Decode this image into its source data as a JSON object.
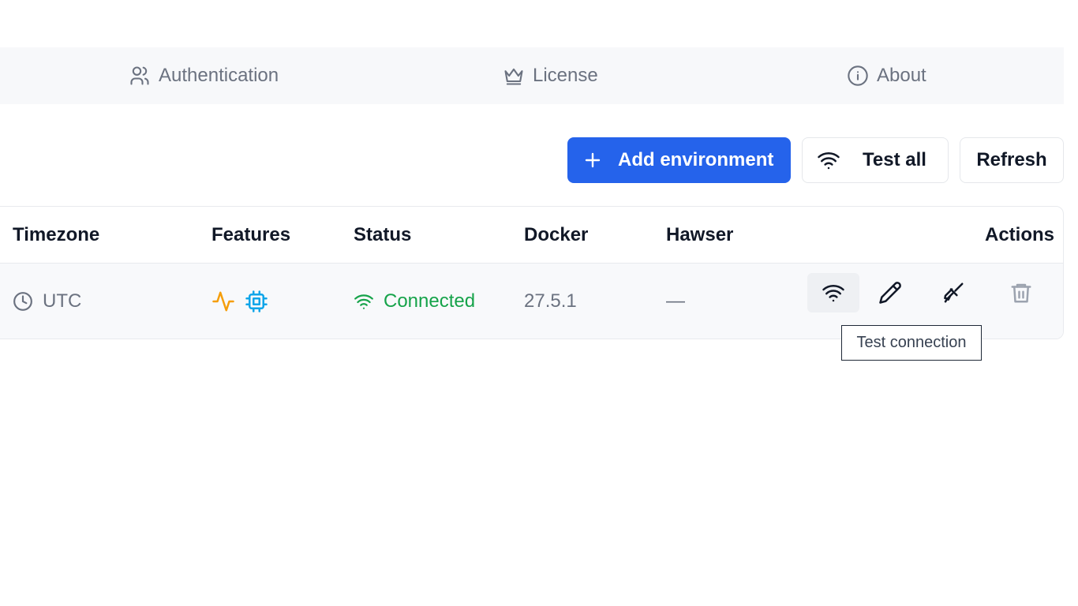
{
  "tabs": [
    {
      "label": "Authentication",
      "icon": "users-icon"
    },
    {
      "label": "License",
      "icon": "crown-icon"
    },
    {
      "label": "About",
      "icon": "info-icon"
    }
  ],
  "toolbar": {
    "add_label": "Add environment",
    "test_all_label": "Test all",
    "refresh_label": "Refresh"
  },
  "table": {
    "headers": {
      "timezone": "Timezone",
      "features": "Features",
      "status": "Status",
      "docker": "Docker",
      "hawser": "Hawser",
      "actions": "Actions"
    },
    "rows": [
      {
        "timezone": "UTC",
        "features": [
          "activity-icon",
          "cpu-icon"
        ],
        "status": "Connected",
        "docker": "27.5.1",
        "hawser": "—"
      }
    ]
  },
  "tooltip": "Test connection",
  "colors": {
    "primary": "#2563eb",
    "connected": "#16a34a",
    "activity": "#f59e0b",
    "cpu": "#0ea5e9"
  }
}
